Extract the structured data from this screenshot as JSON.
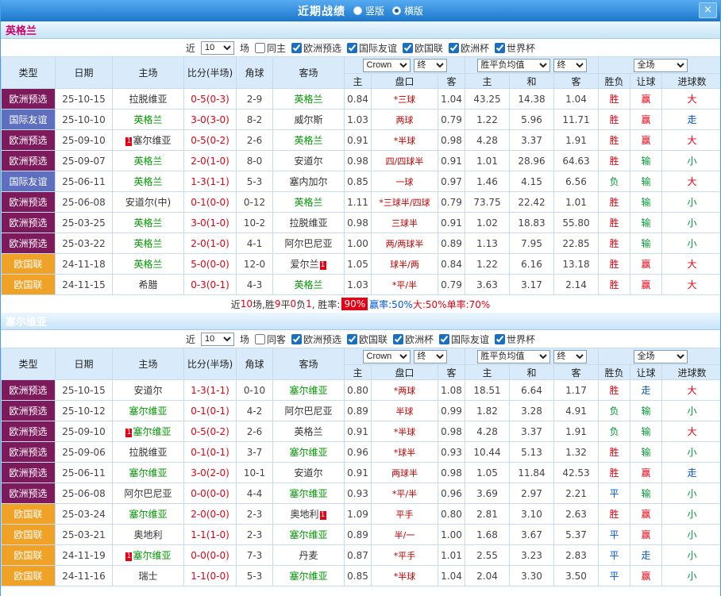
{
  "titlebar": {
    "title": "近期战绩",
    "layout_options": [
      {
        "label": "竖版",
        "selected": false
      },
      {
        "label": "横版",
        "selected": true
      }
    ],
    "close_label": "×"
  },
  "table_header": {
    "type": "类型",
    "date": "日期",
    "home": "主场",
    "score": "比分(半场)",
    "corner": "角球",
    "away": "客场",
    "odds_home": "主",
    "handicap": "盘口",
    "odds_away": "客",
    "wdl_home": "主",
    "wdl_draw": "和",
    "wdl_away": "客",
    "result": "胜负",
    "handicap_result": "让球",
    "goals": "进球数",
    "bookmaker_select": "Crown",
    "final_select": "终",
    "wdl_select": "胜平负均值",
    "scope_select": "全场"
  },
  "red_card_badge": "1",
  "colors": {
    "focus_team": "#009900",
    "opponent_team": "#333333",
    "score": "#E60012",
    "handicap": "#BB0000",
    "titlebar_blue": "#2286D8"
  },
  "type_colors": {
    "欧洲预选": "#7C1A5C",
    "国际友谊": "#5E6FBF",
    "欧国联": "#EFA226"
  },
  "result_colors": {
    "red": "#E60012",
    "green": "#009933",
    "blue": "#0057D8"
  },
  "sections": [
    {
      "team": "英格兰",
      "team_color": "#CC0066",
      "near": {
        "label_before": "近",
        "value": "10",
        "label_after": "场"
      },
      "filters": [
        {
          "label": "同主",
          "checked": false
        },
        {
          "label": "欧洲预选",
          "checked": true
        },
        {
          "label": "国际友谊",
          "checked": true
        },
        {
          "label": "欧国联",
          "checked": true
        },
        {
          "label": "欧洲杯",
          "checked": true
        },
        {
          "label": "世界杯",
          "checked": true
        }
      ],
      "rows": [
        {
          "type": "欧洲预选",
          "date": "25-10-15",
          "home": "拉脱维亚",
          "hf": false,
          "score": "0-5(0-3)",
          "corner": "2-9",
          "away": "英格兰",
          "af": true,
          "o1": "0.84",
          "pan": "*三球",
          "o2": "1.04",
          "w1": "43.25",
          "w2": "14.38",
          "w3": "1.04",
          "sf": "胜",
          "sfc": "red",
          "rq": "赢",
          "rqc": "red",
          "jq": "大",
          "jqc": "red"
        },
        {
          "type": "国际友谊",
          "date": "25-10-10",
          "home": "英格兰",
          "hf": true,
          "score": "3-0(3-0)",
          "corner": "8-2",
          "away": "威尔斯",
          "af": false,
          "o1": "1.03",
          "pan": "两球",
          "o2": "0.79",
          "w1": "1.22",
          "w2": "5.96",
          "w3": "11.71",
          "sf": "胜",
          "sfc": "red",
          "rq": "赢",
          "rqc": "red",
          "jq": "走",
          "jqc": "blue"
        },
        {
          "type": "欧洲预选",
          "date": "25-09-10",
          "home": "塞尔维亚",
          "hf": false,
          "hbadge": "before",
          "score": "0-5(0-2)",
          "corner": "2-6",
          "away": "英格兰",
          "af": true,
          "o1": "0.91",
          "pan": "*半球",
          "o2": "0.98",
          "w1": "4.28",
          "w2": "3.37",
          "w3": "1.91",
          "sf": "胜",
          "sfc": "red",
          "rq": "赢",
          "rqc": "red",
          "jq": "大",
          "jqc": "red"
        },
        {
          "type": "欧洲预选",
          "date": "25-09-07",
          "home": "英格兰",
          "hf": true,
          "score": "2-0(1-0)",
          "corner": "8-0",
          "away": "安道尔",
          "af": false,
          "o1": "0.98",
          "pan": "四/四球半",
          "o2": "0.91",
          "w1": "1.01",
          "w2": "28.96",
          "w3": "64.63",
          "sf": "胜",
          "sfc": "red",
          "rq": "输",
          "rqc": "green",
          "jq": "小",
          "jqc": "green"
        },
        {
          "type": "国际友谊",
          "date": "25-06-11",
          "home": "英格兰",
          "hf": true,
          "score": "1-3(1-1)",
          "corner": "5-3",
          "away": "塞内加尔",
          "af": false,
          "o1": "0.85",
          "pan": "一球",
          "o2": "0.97",
          "w1": "1.46",
          "w2": "4.15",
          "w3": "6.56",
          "sf": "负",
          "sfc": "green",
          "rq": "输",
          "rqc": "green",
          "jq": "大",
          "jqc": "red"
        },
        {
          "type": "欧洲预选",
          "date": "25-06-08",
          "home": "安道尔(中)",
          "hf": false,
          "score": "0-1(0-0)",
          "corner": "0-12",
          "away": "英格兰",
          "af": true,
          "o1": "1.11",
          "pan": "*三球半/四球",
          "o2": "0.79",
          "w1": "73.75",
          "w2": "22.42",
          "w3": "1.01",
          "sf": "胜",
          "sfc": "red",
          "rq": "输",
          "rqc": "green",
          "jq": "小",
          "jqc": "green"
        },
        {
          "type": "欧洲预选",
          "date": "25-03-25",
          "home": "英格兰",
          "hf": true,
          "score": "3-0(1-0)",
          "corner": "10-2",
          "away": "拉脱维亚",
          "af": false,
          "o1": "0.98",
          "pan": "三球半",
          "o2": "0.91",
          "w1": "1.02",
          "w2": "18.83",
          "w3": "55.80",
          "sf": "胜",
          "sfc": "red",
          "rq": "输",
          "rqc": "green",
          "jq": "小",
          "jqc": "green"
        },
        {
          "type": "欧洲预选",
          "date": "25-03-22",
          "home": "英格兰",
          "hf": true,
          "score": "2-0(1-0)",
          "corner": "4-1",
          "away": "阿尔巴尼亚",
          "af": false,
          "o1": "1.00",
          "pan": "两/两球半",
          "o2": "0.89",
          "w1": "1.13",
          "w2": "7.95",
          "w3": "22.85",
          "sf": "胜",
          "sfc": "red",
          "rq": "输",
          "rqc": "green",
          "jq": "小",
          "jqc": "green"
        },
        {
          "type": "欧国联",
          "date": "24-11-18",
          "home": "英格兰",
          "hf": true,
          "score": "5-0(0-0)",
          "corner": "12-0",
          "away": "爱尔兰",
          "af": false,
          "abadge": "after",
          "o1": "1.05",
          "pan": "球半/两",
          "o2": "0.84",
          "w1": "1.22",
          "w2": "6.16",
          "w3": "13.18",
          "sf": "胜",
          "sfc": "red",
          "rq": "赢",
          "rqc": "red",
          "jq": "大",
          "jqc": "red"
        },
        {
          "type": "欧国联",
          "date": "24-11-15",
          "home": "希腊",
          "hf": false,
          "score": "0-3(0-1)",
          "corner": "4-3",
          "away": "英格兰",
          "af": true,
          "o1": "1.03",
          "pan": "*平/半",
          "o2": "0.79",
          "w1": "3.63",
          "w2": "3.17",
          "w3": "2.14",
          "sf": "胜",
          "sfc": "red",
          "rq": "赢",
          "rqc": "red",
          "jq": "大",
          "jqc": "red"
        }
      ],
      "summary": [
        {
          "t": "近",
          "c": "#333333"
        },
        {
          "t": "10",
          "c": "#E60012"
        },
        {
          "t": "场,胜",
          "c": "#333333"
        },
        {
          "t": "9",
          "c": "#E60012"
        },
        {
          "t": "平",
          "c": "#333333"
        },
        {
          "t": "0",
          "c": "#E60012"
        },
        {
          "t": "负",
          "c": "#333333"
        },
        {
          "t": "1",
          "c": "#E60012"
        },
        {
          "t": ", 胜率: ",
          "c": "#333333"
        },
        {
          "t": "90%",
          "c": "#FFFFFF",
          "bg": "#E60012"
        },
        {
          "t": " 赢率:50%",
          "c": "#0057D8"
        },
        {
          "t": " 大:50%",
          "c": "#E60012"
        },
        {
          "t": " 单率:70%",
          "c": "#E60012"
        }
      ]
    },
    {
      "team": "塞尔维亚",
      "team_color": "#FFFFFF",
      "near": {
        "label_before": "近",
        "value": "10",
        "label_after": "场"
      },
      "filters": [
        {
          "label": "同客",
          "checked": false
        },
        {
          "label": "欧洲预选",
          "checked": true
        },
        {
          "label": "欧国联",
          "checked": true
        },
        {
          "label": "欧洲杯",
          "checked": true
        },
        {
          "label": "国际友谊",
          "checked": true
        },
        {
          "label": "世界杯",
          "checked": true
        }
      ],
      "rows": [
        {
          "type": "欧洲预选",
          "date": "25-10-15",
          "home": "安道尔",
          "hf": false,
          "score": "1-3(1-1)",
          "corner": "0-10",
          "away": "塞尔维亚",
          "af": true,
          "o1": "0.80",
          "pan": "*两球",
          "o2": "1.08",
          "w1": "18.51",
          "w2": "6.64",
          "w3": "1.17",
          "sf": "胜",
          "sfc": "red",
          "rq": "走",
          "rqc": "blue",
          "jq": "大",
          "jqc": "red"
        },
        {
          "type": "欧洲预选",
          "date": "25-10-12",
          "home": "塞尔维亚",
          "hf": true,
          "score": "0-1(0-1)",
          "corner": "4-2",
          "away": "阿尔巴尼亚",
          "af": false,
          "o1": "0.89",
          "pan": "半球",
          "o2": "0.99",
          "w1": "1.82",
          "w2": "3.28",
          "w3": "4.91",
          "sf": "负",
          "sfc": "green",
          "rq": "输",
          "rqc": "green",
          "jq": "小",
          "jqc": "green"
        },
        {
          "type": "欧洲预选",
          "date": "25-09-10",
          "home": "塞尔维亚",
          "hf": true,
          "hbadge": "before",
          "score": "0-5(0-2)",
          "corner": "2-6",
          "away": "英格兰",
          "af": false,
          "o1": "0.91",
          "pan": "*半球",
          "o2": "0.98",
          "w1": "4.28",
          "w2": "3.37",
          "w3": "1.91",
          "sf": "负",
          "sfc": "green",
          "rq": "输",
          "rqc": "green",
          "jq": "大",
          "jqc": "red"
        },
        {
          "type": "欧洲预选",
          "date": "25-09-06",
          "home": "拉脱维亚",
          "hf": false,
          "score": "0-1(0-1)",
          "corner": "3-7",
          "away": "塞尔维亚",
          "af": true,
          "o1": "0.96",
          "pan": "*球半",
          "o2": "0.93",
          "w1": "10.44",
          "w2": "5.13",
          "w3": "1.32",
          "sf": "胜",
          "sfc": "red",
          "rq": "输",
          "rqc": "green",
          "jq": "小",
          "jqc": "green"
        },
        {
          "type": "欧洲预选",
          "date": "25-06-11",
          "home": "塞尔维亚",
          "hf": true,
          "score": "3-0(2-0)",
          "corner": "10-1",
          "away": "安道尔",
          "af": false,
          "o1": "0.91",
          "pan": "两球半",
          "o2": "0.98",
          "w1": "1.05",
          "w2": "11.84",
          "w3": "42.53",
          "sf": "胜",
          "sfc": "red",
          "rq": "赢",
          "rqc": "red",
          "jq": "走",
          "jqc": "blue"
        },
        {
          "type": "欧洲预选",
          "date": "25-06-08",
          "home": "阿尔巴尼亚",
          "hf": false,
          "score": "0-0(0-0)",
          "corner": "4-4",
          "away": "塞尔维亚",
          "af": true,
          "o1": "0.93",
          "pan": "*平/半",
          "o2": "0.96",
          "w1": "3.69",
          "w2": "2.97",
          "w3": "2.21",
          "sf": "平",
          "sfc": "blue",
          "rq": "输",
          "rqc": "green",
          "jq": "小",
          "jqc": "green"
        },
        {
          "type": "欧国联",
          "date": "25-03-24",
          "home": "塞尔维亚",
          "hf": true,
          "score": "2-0(0-0)",
          "corner": "2-3",
          "away": "奥地利",
          "af": false,
          "abadge": "after",
          "o1": "1.09",
          "pan": "平手",
          "o2": "0.80",
          "w1": "2.81",
          "w2": "3.10",
          "w3": "2.63",
          "sf": "胜",
          "sfc": "red",
          "rq": "赢",
          "rqc": "red",
          "jq": "小",
          "jqc": "green"
        },
        {
          "type": "欧国联",
          "date": "25-03-21",
          "home": "奥地利",
          "hf": false,
          "score": "1-1(1-0)",
          "corner": "2-3",
          "away": "塞尔维亚",
          "af": true,
          "o1": "0.89",
          "pan": "半/一",
          "o2": "1.00",
          "w1": "1.68",
          "w2": "3.67",
          "w3": "5.37",
          "sf": "平",
          "sfc": "blue",
          "rq": "赢",
          "rqc": "red",
          "jq": "小",
          "jqc": "green"
        },
        {
          "type": "欧国联",
          "date": "24-11-19",
          "home": "塞尔维亚",
          "hf": true,
          "hbadge": "before",
          "score": "0-0(0-0)",
          "corner": "7-3",
          "away": "丹麦",
          "af": false,
          "o1": "0.87",
          "pan": "*平手",
          "o2": "1.01",
          "w1": "2.55",
          "w2": "3.23",
          "w3": "2.83",
          "sf": "平",
          "sfc": "blue",
          "rq": "走",
          "rqc": "blue",
          "jq": "小",
          "jqc": "green"
        },
        {
          "type": "欧国联",
          "date": "24-11-16",
          "home": "瑞士",
          "hf": false,
          "score": "1-1(0-0)",
          "corner": "5-3",
          "away": "塞尔维亚",
          "af": true,
          "o1": "0.85",
          "pan": "*半球",
          "o2": "1.04",
          "w1": "2.04",
          "w2": "3.30",
          "w3": "3.50",
          "sf": "平",
          "sfc": "blue",
          "rq": "赢",
          "rqc": "red",
          "jq": "小",
          "jqc": "green"
        }
      ]
    }
  ]
}
